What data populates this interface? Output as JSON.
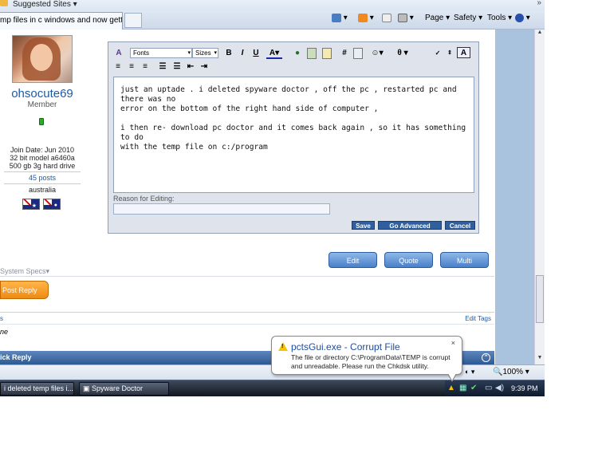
{
  "browser": {
    "fav_label": "Suggested Sites",
    "tab_title": "mp files in c windows and now gettin...",
    "commands": [
      "Page",
      "Safety",
      "Tools"
    ],
    "zoom": "100%"
  },
  "user": {
    "name": "ohsocute69",
    "rank": "Member",
    "join_date": "Join Date: Jun 2010",
    "system": "32 bit model a6460a 500 gb 3g hard drive",
    "posts": "45 posts",
    "location": "australia"
  },
  "editor": {
    "font_select": "Fonts",
    "size_select": "Sizes",
    "body_line1": "just an uptade . i deleted spyware doctor , off the pc , restarted pc and there was no\nerror on the bottom of the right hand side of computer ,",
    "body_line2": "i then re- download pc doctor and it comes back again , so it has something to do\nwith the temp file on c:/program",
    "reason_label": "Reason for Editing:",
    "save": "Save",
    "go_advanced": "Go Advanced",
    "cancel": "Cancel"
  },
  "post_buttons": {
    "edit": "Edit",
    "quote": "Quote",
    "multi": "Multi"
  },
  "thread": {
    "system_specs": "System Specs",
    "post_reply": "Post Reply",
    "tags_left": "s",
    "edit_tags": "Edit Tags",
    "tags_value": "ne",
    "quick_reply": "ick Reply"
  },
  "taskbar": {
    "items": [
      "i deleted temp files i...",
      "Spyware Doctor"
    ],
    "clock": "9:39 PM"
  },
  "balloon": {
    "title": "pctsGui.exe - Corrupt File",
    "message": "The file or directory C:\\ProgramData\\TEMP is corrupt and unreadable. Please run the Chkdsk utility."
  }
}
